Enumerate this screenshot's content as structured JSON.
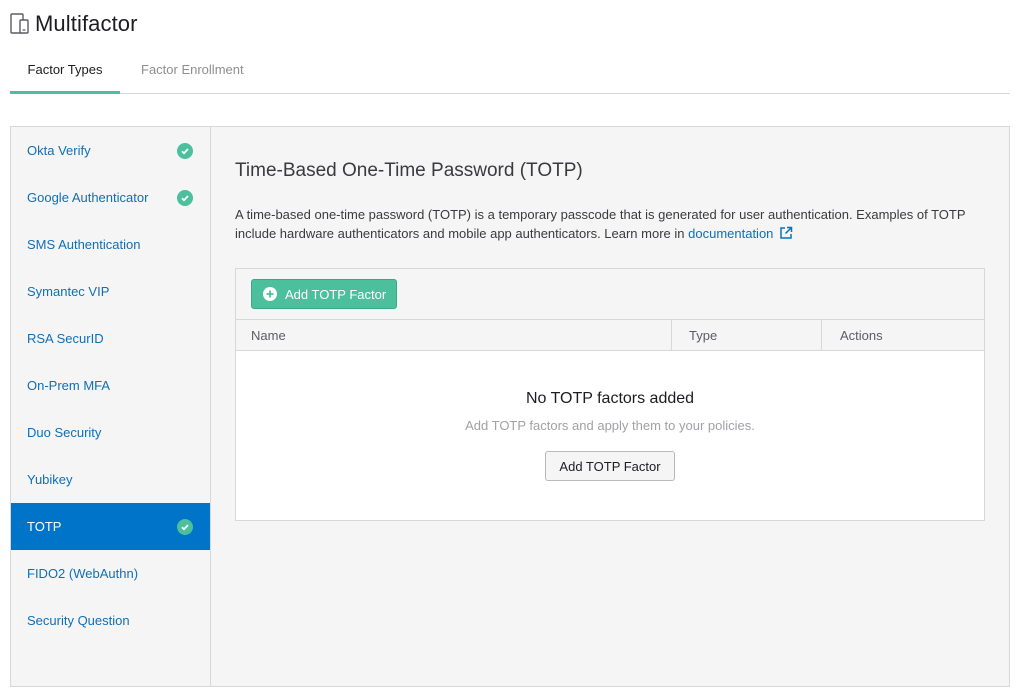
{
  "header": {
    "title": "Multifactor",
    "icon": "device-icon"
  },
  "tabs": [
    {
      "label": "Factor Types",
      "active": true
    },
    {
      "label": "Factor Enrollment",
      "active": false
    }
  ],
  "sidebar": {
    "items": [
      {
        "label": "Okta Verify",
        "enabled": true
      },
      {
        "label": "Google Authenticator",
        "enabled": true
      },
      {
        "label": "SMS Authentication",
        "enabled": false
      },
      {
        "label": "Symantec VIP",
        "enabled": false
      },
      {
        "label": "RSA SecurID",
        "enabled": false
      },
      {
        "label": "On-Prem MFA",
        "enabled": false
      },
      {
        "label": "Duo Security",
        "enabled": false
      },
      {
        "label": "Yubikey",
        "enabled": false
      },
      {
        "label": "TOTP",
        "enabled": true,
        "active": true
      },
      {
        "label": "FIDO2 (WebAuthn)",
        "enabled": false
      },
      {
        "label": "Security Question",
        "enabled": false
      }
    ]
  },
  "main": {
    "title": "Time-Based One-Time Password (TOTP)",
    "description": "A time-based one-time password (TOTP) is a temporary passcode that is generated for user authentication. Examples of TOTP include hardware authenticators and mobile app authenticators. Learn more in",
    "doc_link": "documentation",
    "add_button": "Add TOTP Factor",
    "columns": [
      "Name",
      "Type",
      "Actions"
    ],
    "empty_title": "No TOTP factors added",
    "empty_subtitle": "Add TOTP factors and apply them to your policies.",
    "empty_button": "Add TOTP Factor"
  },
  "colors": {
    "accent": "#4cbf9c",
    "active_nav": "#0074c8",
    "link": "#0f6fb8"
  }
}
